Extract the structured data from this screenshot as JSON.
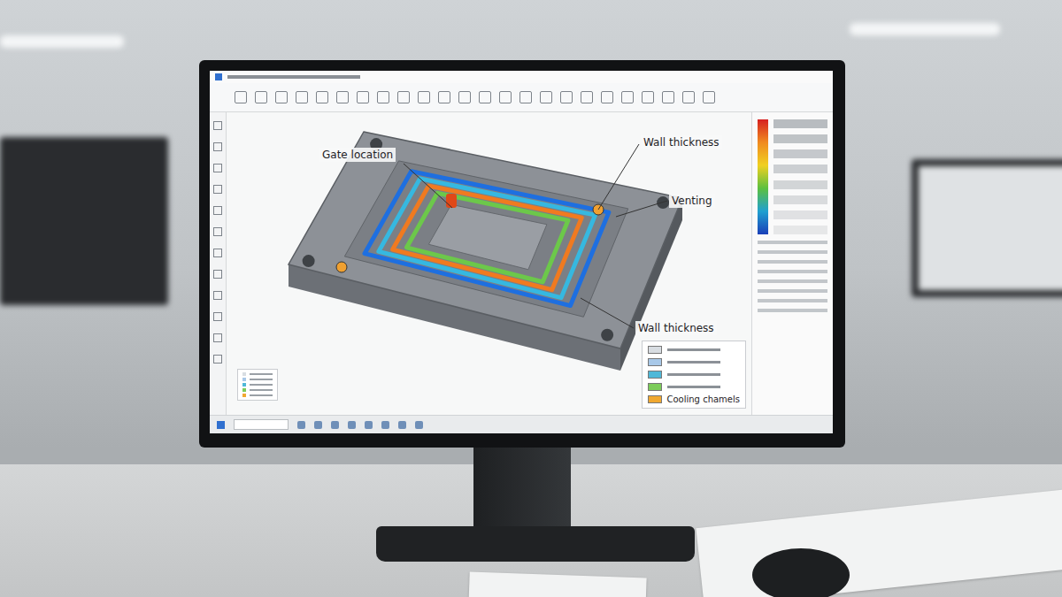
{
  "screen": {
    "callouts": [
      {
        "label": "Gate location"
      },
      {
        "label": "Wall thickness"
      },
      {
        "label": "Venting"
      },
      {
        "label": "Wall thickness"
      }
    ],
    "channels": [
      {
        "color": "#1e6fe0"
      },
      {
        "color": "#36b8e0"
      },
      {
        "color": "#f07a20"
      },
      {
        "color": "#6cc84a"
      }
    ],
    "legend": [
      {
        "color": "#d8dde2",
        "label": ""
      },
      {
        "color": "#a8c8e8",
        "label": ""
      },
      {
        "color": "#4fb8d8",
        "label": ""
      },
      {
        "color": "#7ccc5a",
        "label": ""
      },
      {
        "color": "#f0a830",
        "label": "Cooling chamels"
      }
    ],
    "scale": {
      "colors": [
        "#d62020",
        "#f08a20",
        "#f0d020",
        "#5cc040",
        "#20a0d0",
        "#1a3fb8"
      ]
    }
  }
}
